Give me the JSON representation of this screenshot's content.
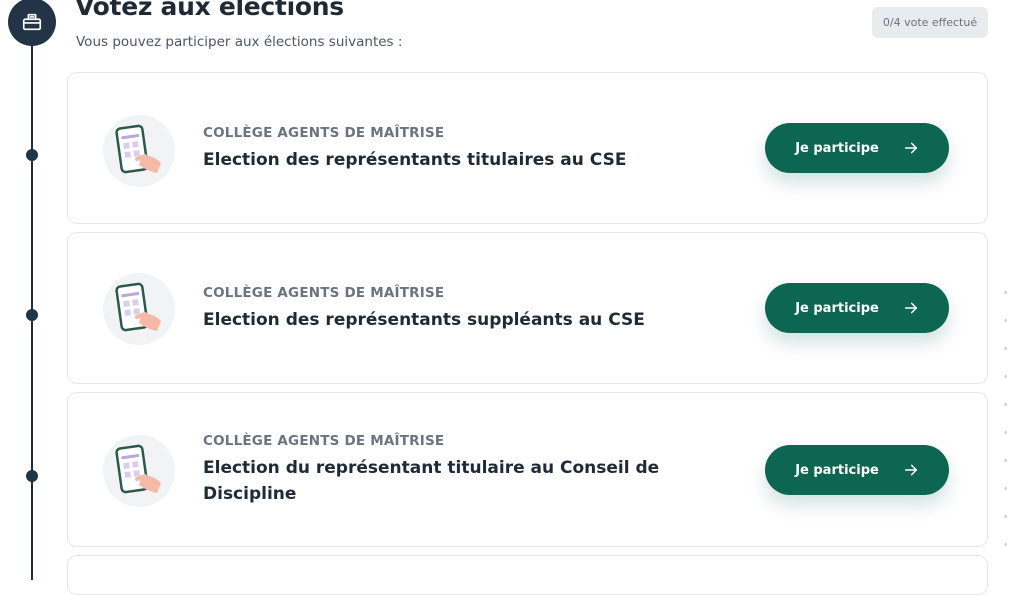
{
  "header": {
    "title": "Votez aux élections",
    "subtitle": "Vous pouvez participer aux élections suivantes :",
    "vote_counter": "0/4 vote effectué"
  },
  "icons": {
    "section": "ballot-box-icon",
    "card_illustration": "phone-vote-icon",
    "cta_arrow": "arrow-right-icon"
  },
  "colors": {
    "primary": "#0d6652",
    "timeline": "#243447",
    "counter_bg": "#e9ecef"
  },
  "elections": [
    {
      "college": "COLLÈGE AGENTS DE MAÎTRISE",
      "title": "Election des représentants titulaires au CSE",
      "cta": "Je participe"
    },
    {
      "college": "COLLÈGE AGENTS DE MAÎTRISE",
      "title": "Election des représentants suppléants au CSE",
      "cta": "Je participe"
    },
    {
      "college": "COLLÈGE AGENTS DE MAÎTRISE",
      "title": "Election du représentant titulaire au Conseil de Discipline",
      "cta": "Je participe"
    }
  ]
}
